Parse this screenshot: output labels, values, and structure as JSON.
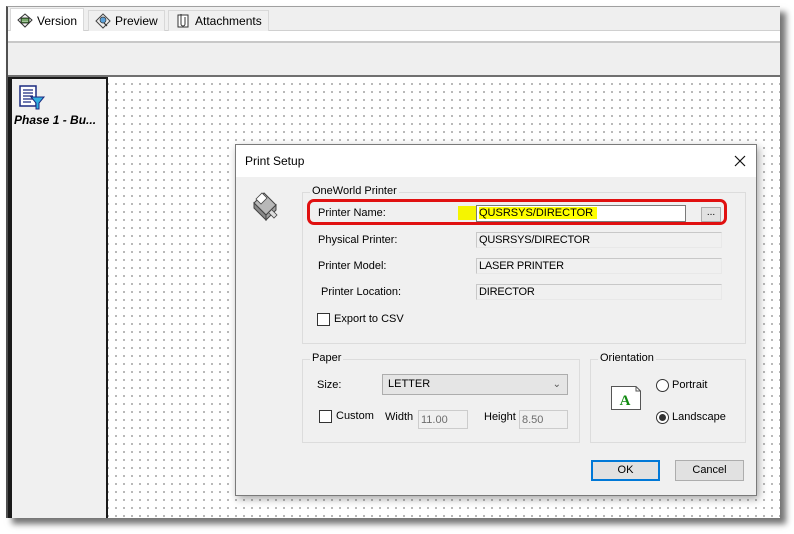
{
  "tabs": [
    {
      "label": "Version",
      "icon": "version-icon",
      "active": true
    },
    {
      "label": "Preview",
      "icon": "preview-icon",
      "active": false
    },
    {
      "label": "Attachments",
      "icon": "attachments-icon",
      "active": false
    }
  ],
  "left_pane": {
    "report_label": "Phase 1 - Bu...",
    "report_icon": "report-filter-icon"
  },
  "dialog": {
    "title": "Print Setup",
    "close_icon": "close-icon",
    "printer_icon": "printer-icon",
    "oneworld_group": {
      "legend": "OneWorld Printer",
      "printer_name_label": "Printer Name:",
      "printer_name_value": "QUSRSYS/DIRECTOR",
      "browse_label": "...",
      "physical_printer_label": "Physical Printer:",
      "physical_printer_value": "QUSRSYS/DIRECTOR",
      "printer_model_label": "Printer Model:",
      "printer_model_value": "LASER PRINTER",
      "printer_location_label": "Printer Location:",
      "printer_location_value": "DIRECTOR",
      "export_csv_label": "Export to CSV",
      "export_csv_checked": false
    },
    "paper_group": {
      "legend": "Paper",
      "size_label": "Size:",
      "size_value": "LETTER",
      "custom_label": "Custom",
      "custom_checked": false,
      "width_label": "Width",
      "width_value": "11.00",
      "height_label": "Height",
      "height_value": "8.50"
    },
    "orientation_group": {
      "legend": "Orientation",
      "preview_letter": "A",
      "portrait_label": "Portrait",
      "landscape_label": "Landscape",
      "selected": "Landscape"
    },
    "ok_label": "OK",
    "cancel_label": "Cancel"
  },
  "annotation": {
    "highlight_color": "#ffff00",
    "callout_color": "#e01010"
  }
}
